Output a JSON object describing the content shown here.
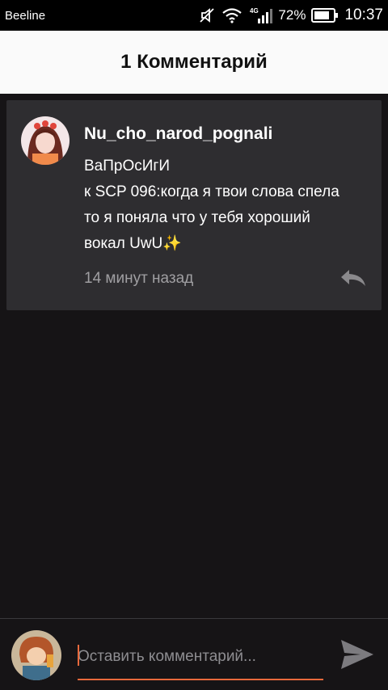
{
  "status_bar": {
    "carrier": "Beeline",
    "network_type": "4G",
    "battery_percent": "72%",
    "time": "10:37"
  },
  "header": {
    "title": "1 Комментарий"
  },
  "comment": {
    "author": "Nu_cho_narod_pognali",
    "lines": [
      "ВаПрОсИгИ",
      "к SCP 096:когда я твои слова спела",
      "то я поняла что у тебя хороший",
      "вокал UwU"
    ],
    "sparkle": "✨",
    "time": "14 минут назад"
  },
  "compose": {
    "placeholder": "Оставить комментарий..."
  },
  "colors": {
    "accent": "#e8693c",
    "background": "#161416",
    "card": "#2e2d30",
    "header": "#fafafa"
  }
}
